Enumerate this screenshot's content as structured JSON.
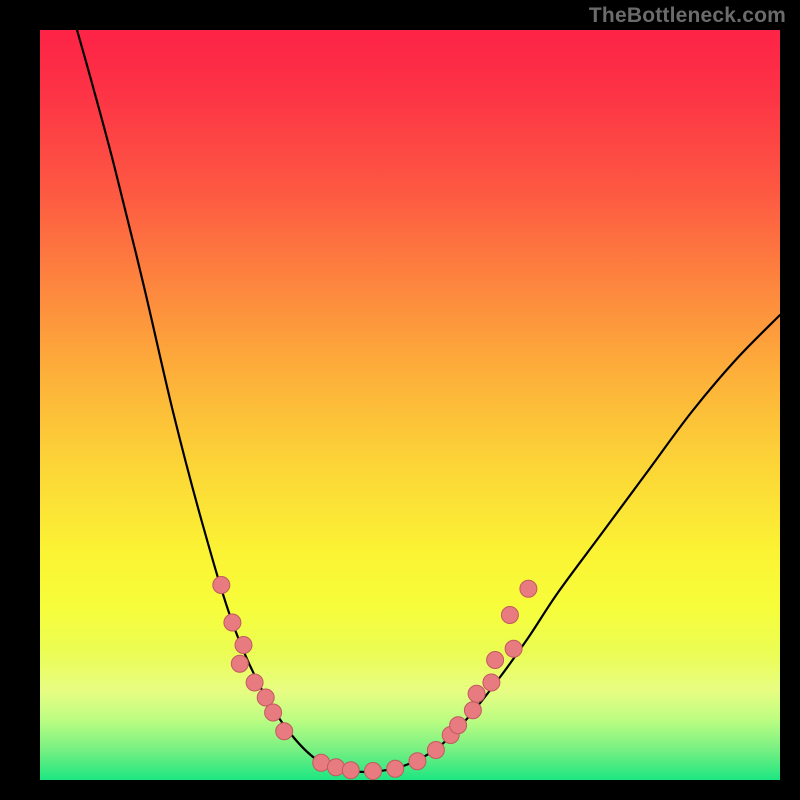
{
  "watermark": "TheBottleneck.com",
  "colors": {
    "background": "#000000",
    "curve_stroke": "#000000",
    "marker_fill": "#e77b80",
    "marker_stroke": "#c15a60"
  },
  "chart_data": {
    "type": "line",
    "title": "",
    "xlabel": "",
    "ylabel": "",
    "xlim": [
      0,
      100
    ],
    "ylim": [
      0,
      100
    ],
    "grid": false,
    "curve": [
      {
        "x": 5,
        "y": 100
      },
      {
        "x": 7,
        "y": 93
      },
      {
        "x": 10,
        "y": 82
      },
      {
        "x": 14,
        "y": 66
      },
      {
        "x": 18,
        "y": 49
      },
      {
        "x": 22,
        "y": 34
      },
      {
        "x": 26,
        "y": 21
      },
      {
        "x": 30,
        "y": 12
      },
      {
        "x": 34,
        "y": 6
      },
      {
        "x": 38,
        "y": 2.3
      },
      {
        "x": 42,
        "y": 1.2
      },
      {
        "x": 46,
        "y": 1.2
      },
      {
        "x": 50,
        "y": 2.2
      },
      {
        "x": 54,
        "y": 4.5
      },
      {
        "x": 58,
        "y": 8.5
      },
      {
        "x": 62,
        "y": 13.5
      },
      {
        "x": 66,
        "y": 19
      },
      {
        "x": 70,
        "y": 25
      },
      {
        "x": 76,
        "y": 33
      },
      {
        "x": 82,
        "y": 41
      },
      {
        "x": 88,
        "y": 49
      },
      {
        "x": 94,
        "y": 56
      },
      {
        "x": 100,
        "y": 62
      }
    ],
    "markers": [
      {
        "x": 24.5,
        "y": 26
      },
      {
        "x": 26.0,
        "y": 21
      },
      {
        "x": 27.5,
        "y": 18
      },
      {
        "x": 27.0,
        "y": 15.5
      },
      {
        "x": 29.0,
        "y": 13
      },
      {
        "x": 30.5,
        "y": 11
      },
      {
        "x": 31.5,
        "y": 9
      },
      {
        "x": 33.0,
        "y": 6.5
      },
      {
        "x": 38.0,
        "y": 2.3
      },
      {
        "x": 40.0,
        "y": 1.7
      },
      {
        "x": 42.0,
        "y": 1.3
      },
      {
        "x": 45.0,
        "y": 1.2
      },
      {
        "x": 48.0,
        "y": 1.5
      },
      {
        "x": 51.0,
        "y": 2.5
      },
      {
        "x": 53.5,
        "y": 4.0
      },
      {
        "x": 55.5,
        "y": 6.0
      },
      {
        "x": 56.5,
        "y": 7.3
      },
      {
        "x": 58.5,
        "y": 9.3
      },
      {
        "x": 59.0,
        "y": 11.5
      },
      {
        "x": 61.0,
        "y": 13.0
      },
      {
        "x": 61.5,
        "y": 16.0
      },
      {
        "x": 64.0,
        "y": 17.5
      },
      {
        "x": 63.5,
        "y": 22.0
      },
      {
        "x": 66.0,
        "y": 25.5
      }
    ]
  }
}
